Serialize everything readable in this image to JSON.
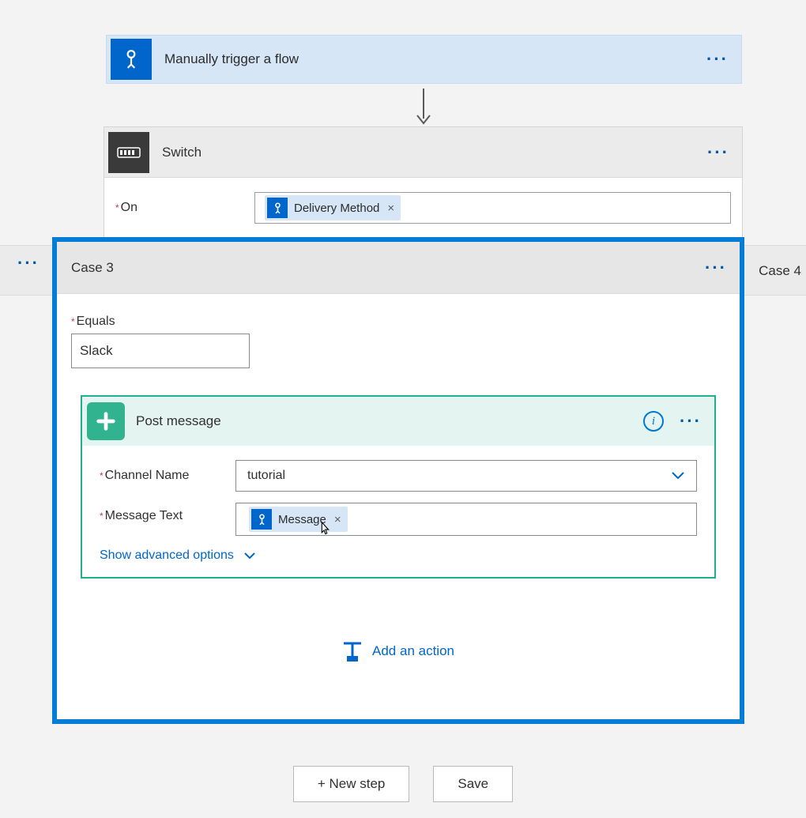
{
  "trigger": {
    "title": "Manually trigger a flow"
  },
  "switch": {
    "title": "Switch",
    "on_label": "On",
    "token": "Delivery Method"
  },
  "branches": {
    "right_case": "Case 4"
  },
  "case3": {
    "title": "Case 3",
    "equals_label": "Equals",
    "equals_value": "Slack",
    "slack": {
      "title": "Post message",
      "channel_label": "Channel Name",
      "channel_value": "tutorial",
      "message_label": "Message Text",
      "message_token": "Message",
      "advanced": "Show advanced options"
    },
    "add_action": "Add an action"
  },
  "footer": {
    "new_step": "+ New step",
    "save": "Save"
  }
}
